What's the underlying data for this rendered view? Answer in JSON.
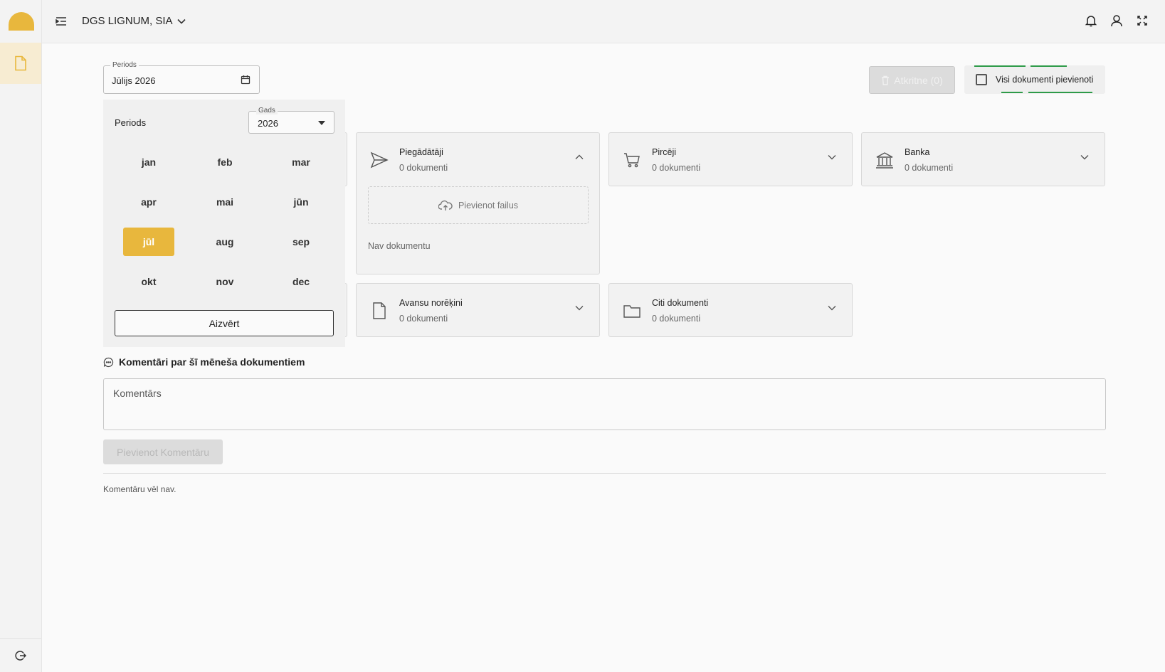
{
  "header": {
    "company": "DGS LIGNUM, SIA"
  },
  "period_field": {
    "legend": "Periods",
    "value": "Jūlijs 2026"
  },
  "actions": {
    "trash_label": "Atkritne (0)",
    "all_docs_label": "Visi dokumenti pievienoti"
  },
  "picker": {
    "title": "Periods",
    "year_legend": "Gads",
    "year_value": "2026",
    "months": [
      "jan",
      "feb",
      "mar",
      "apr",
      "mai",
      "jūn",
      "jūl",
      "aug",
      "sep",
      "okt",
      "nov",
      "dec"
    ],
    "selected_month": "jūl",
    "close_label": "Aizvērt"
  },
  "cards": {
    "suppliers": {
      "title": "Piegādātāji",
      "count": "0 dokumenti",
      "upload_label": "Pievienot failus",
      "empty_label": "Nav dokumentu"
    },
    "buyers": {
      "title": "Pircēji",
      "count": "0 dokumenti"
    },
    "bank": {
      "title": "Banka",
      "count": "0 dokumenti"
    },
    "advance": {
      "title": "Avansu norēķini",
      "count": "0 dokumenti"
    },
    "other": {
      "title": "Citi dokumenti",
      "count": "0 dokumenti"
    }
  },
  "comments": {
    "heading": "Komentāri par šī mēneša dokumentiem",
    "placeholder": "Komentārs",
    "add_label": "Pievienot Komentāru",
    "empty_label": "Komentāru vēl nav."
  },
  "colors": {
    "accent": "#e8b73d",
    "success_line": "#2e9b49"
  }
}
